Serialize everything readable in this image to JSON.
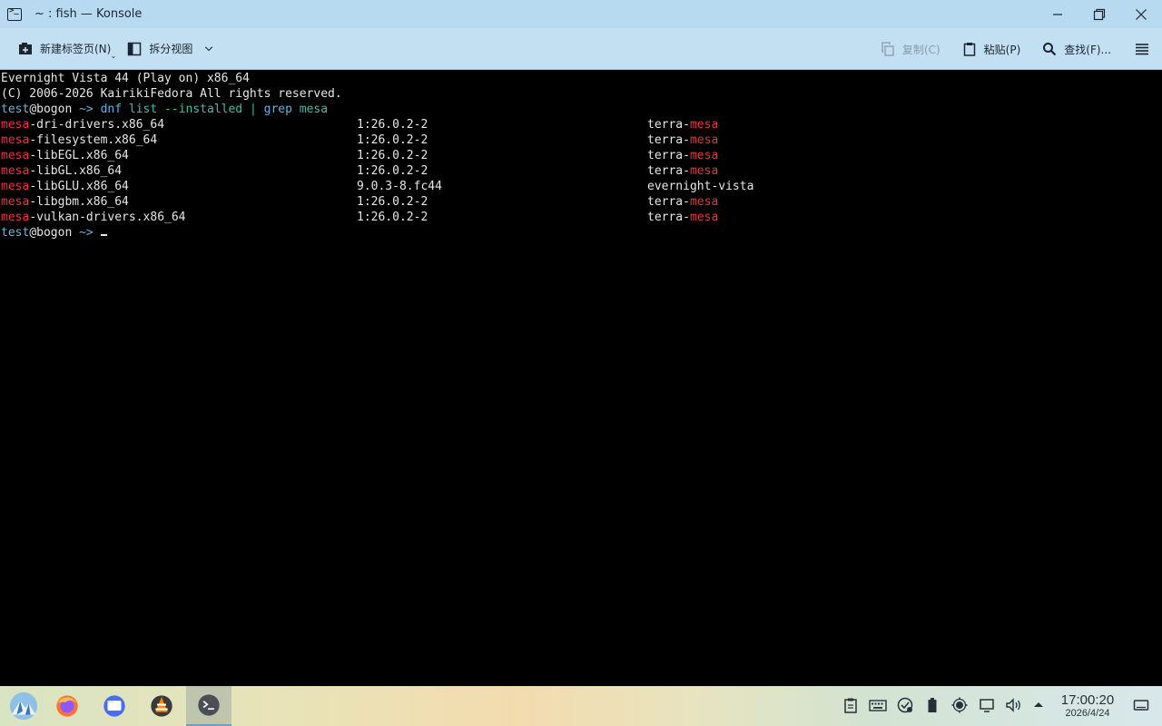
{
  "window": {
    "title": "~ : fish — Konsole"
  },
  "toolbar": {
    "new_tab_label": "新建标签页(N)",
    "split_view_label": "拆分视图",
    "copy_label": "复制(C)",
    "paste_label": "粘贴(P)",
    "find_label": "查找(F)..."
  },
  "terminal": {
    "banner_line1": "Evernight Vista 44 (Play on) x86_64",
    "banner_line2": "(C) 2006-2026 KairikiFedora All rights reserved.",
    "prompt_user": "test",
    "prompt_host": "@bogon",
    "prompt_path": " ~> ",
    "command": {
      "program": "dnf",
      "sub": " list",
      "flag": " --installed",
      "pipe": " |",
      "grep": " grep",
      "pattern": " mesa"
    },
    "highlight": "mesa",
    "rows": [
      {
        "name_rest": "-dri-drivers.x86_64",
        "version": "1:26.0.2-2",
        "repo_prefix": "terra-",
        "repo_hl": "mesa"
      },
      {
        "name_rest": "-filesystem.x86_64",
        "version": "1:26.0.2-2",
        "repo_prefix": "terra-",
        "repo_hl": "mesa"
      },
      {
        "name_rest": "-libEGL.x86_64",
        "version": "1:26.0.2-2",
        "repo_prefix": "terra-",
        "repo_hl": "mesa"
      },
      {
        "name_rest": "-libGL.x86_64",
        "version": "1:26.0.2-2",
        "repo_prefix": "terra-",
        "repo_hl": "mesa"
      },
      {
        "name_rest": "-libGLU.x86_64",
        "version": "9.0.3-8.fc44",
        "repo_prefix": "evernight-vista",
        "repo_hl": ""
      },
      {
        "name_rest": "-libgbm.x86_64",
        "version": "1:26.0.2-2",
        "repo_prefix": "terra-",
        "repo_hl": "mesa"
      },
      {
        "name_rest": "-vulkan-drivers.x86_64",
        "version": "1:26.0.2-2",
        "repo_prefix": "terra-",
        "repo_hl": "mesa"
      }
    ]
  },
  "taskbar": {
    "apps": [
      {
        "icon": "app-launcher-icon"
      },
      {
        "icon": "firefox-icon"
      },
      {
        "icon": "file-manager-icon"
      },
      {
        "icon": "vlc-icon"
      },
      {
        "icon": "konsole-icon",
        "active": true
      }
    ],
    "tray_icons": [
      "clipboard-icon",
      "keyboard-icon",
      "updates-icon",
      "battery-icon",
      "brightness-icon",
      "display-icon",
      "volume-icon",
      "tray-expand-icon"
    ],
    "clock_time": "17:00:20",
    "clock_date": "2026/4/24"
  }
}
